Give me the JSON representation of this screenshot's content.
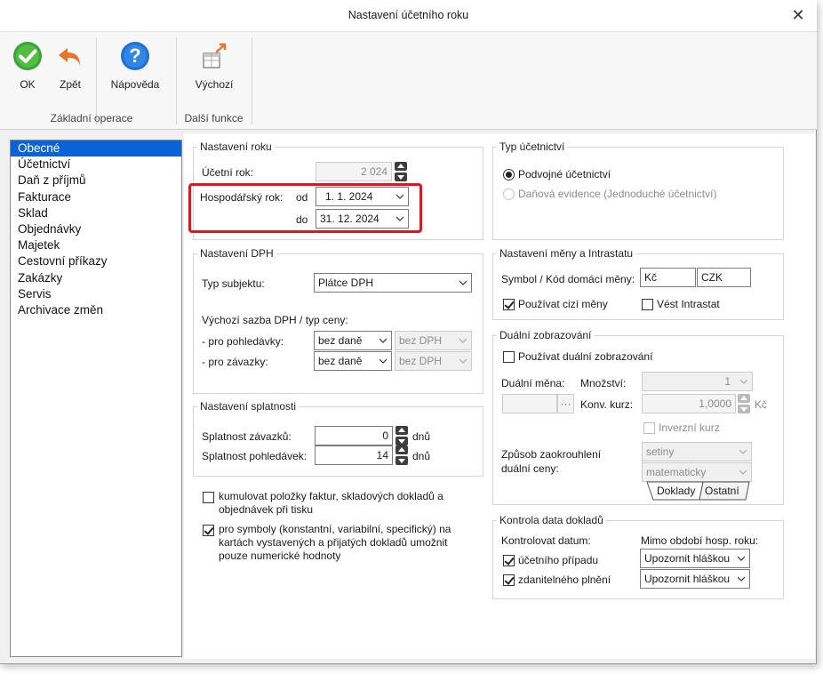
{
  "window": {
    "title": "Nastavení účetního roku",
    "close": "✕"
  },
  "ribbon": {
    "ok": "OK",
    "back": "Zpět",
    "help": "Nápověda",
    "default": "Výchozí",
    "group_basic": "Základní operace",
    "group_more": "Další funkce",
    "help_glyph": "?"
  },
  "nav": {
    "items": [
      "Obecné",
      "Účetnictví",
      "Daň z příjmů",
      "Fakturace",
      "Sklad",
      "Objednávky",
      "Majetek",
      "Cestovní příkazy",
      "Zakázky",
      "Servis",
      "Archivace změn"
    ],
    "selected": 0
  },
  "year": {
    "legend": "Nastavení roku",
    "label_year": "Účetní rok:",
    "year_value": "2 024",
    "label_fiscal": "Hospodářský rok:",
    "from_label": "od",
    "to_label": "do",
    "from_value": "1.   1. 2024",
    "to_value": "31. 12. 2024"
  },
  "vat": {
    "legend": "Nastavení DPH",
    "subject_label": "Typ subjektu:",
    "subject_value": "Plátce DPH",
    "default_rate_label": "Výchozí sazba DPH / typ ceny:",
    "receivables_label": "- pro pohledávky:",
    "payables_label": "- pro závazky:",
    "rate_receivables": "bez daně",
    "rate_payables": "bez daně",
    "type_receivables": "bez DPH",
    "type_payables": "bez DPH"
  },
  "due": {
    "legend": "Nastavení splatnosti",
    "payables_label": "Splatnost závazků:",
    "payables_value": "0",
    "receivables_label": "Splatnost pohledávek:",
    "receivables_value": "14",
    "unit": "dnů"
  },
  "options": {
    "cumulate": "kumulovat položky faktur, skladových dokladů a objednávek při tisku",
    "numeric_symbols": "pro symboly (konstantní, variabilní, specifický) na kartách vystavených a přijatých dokladů umožnit pouze numerické hodnoty",
    "cumulate_checked": false,
    "numeric_checked": true
  },
  "accounting_type": {
    "legend": "Typ účetnictví",
    "double": "Podvojné účetnictví",
    "simple": "Daňová evidence (Jednoduché účetnictví)"
  },
  "currency": {
    "legend": "Nastavení měny a Intrastatu",
    "symbol_label": "Symbol / Kód domácí měny:",
    "symbol_value": "Kč",
    "code_value": "CZK",
    "use_foreign": "Používat cizí měny",
    "intrastat": "Vést Intrastat"
  },
  "dual": {
    "legend": "Duální zobrazování",
    "use_dual": "Používat duální zobrazování",
    "currency_label": "Duální měna:",
    "quantity_label": "Množství:",
    "quantity_value": "1",
    "rate_label": "Konv. kurz:",
    "rate_value": "1,0000",
    "rate_unit": "Kč",
    "browse": "···",
    "inverse": "Inverzní kurz",
    "rounding_label_1": "Způsob zaokrouhlení",
    "rounding_label_2": "duální ceny:",
    "rounding_1": "setiny",
    "rounding_2": "matematicky",
    "tab_docs": "Doklady",
    "tab_other": "Ostatní"
  },
  "date_check": {
    "legend": "Kontrola data dokladů",
    "check_label": "Kontrolovat datum:",
    "outside_label": "Mimo období hosp. roku:",
    "case_label": "účetního případu",
    "taxable_label": "zdanitelného plnění",
    "case_action": "Upozornit hláškou",
    "taxable_action": "Upozornit hláškou"
  },
  "colors": {
    "accent": "#0a63d6",
    "highlight": "#e0151f",
    "ok_green": "#3aa23a",
    "help_blue": "#1f6fd1",
    "back_orange": "#e8742a"
  }
}
